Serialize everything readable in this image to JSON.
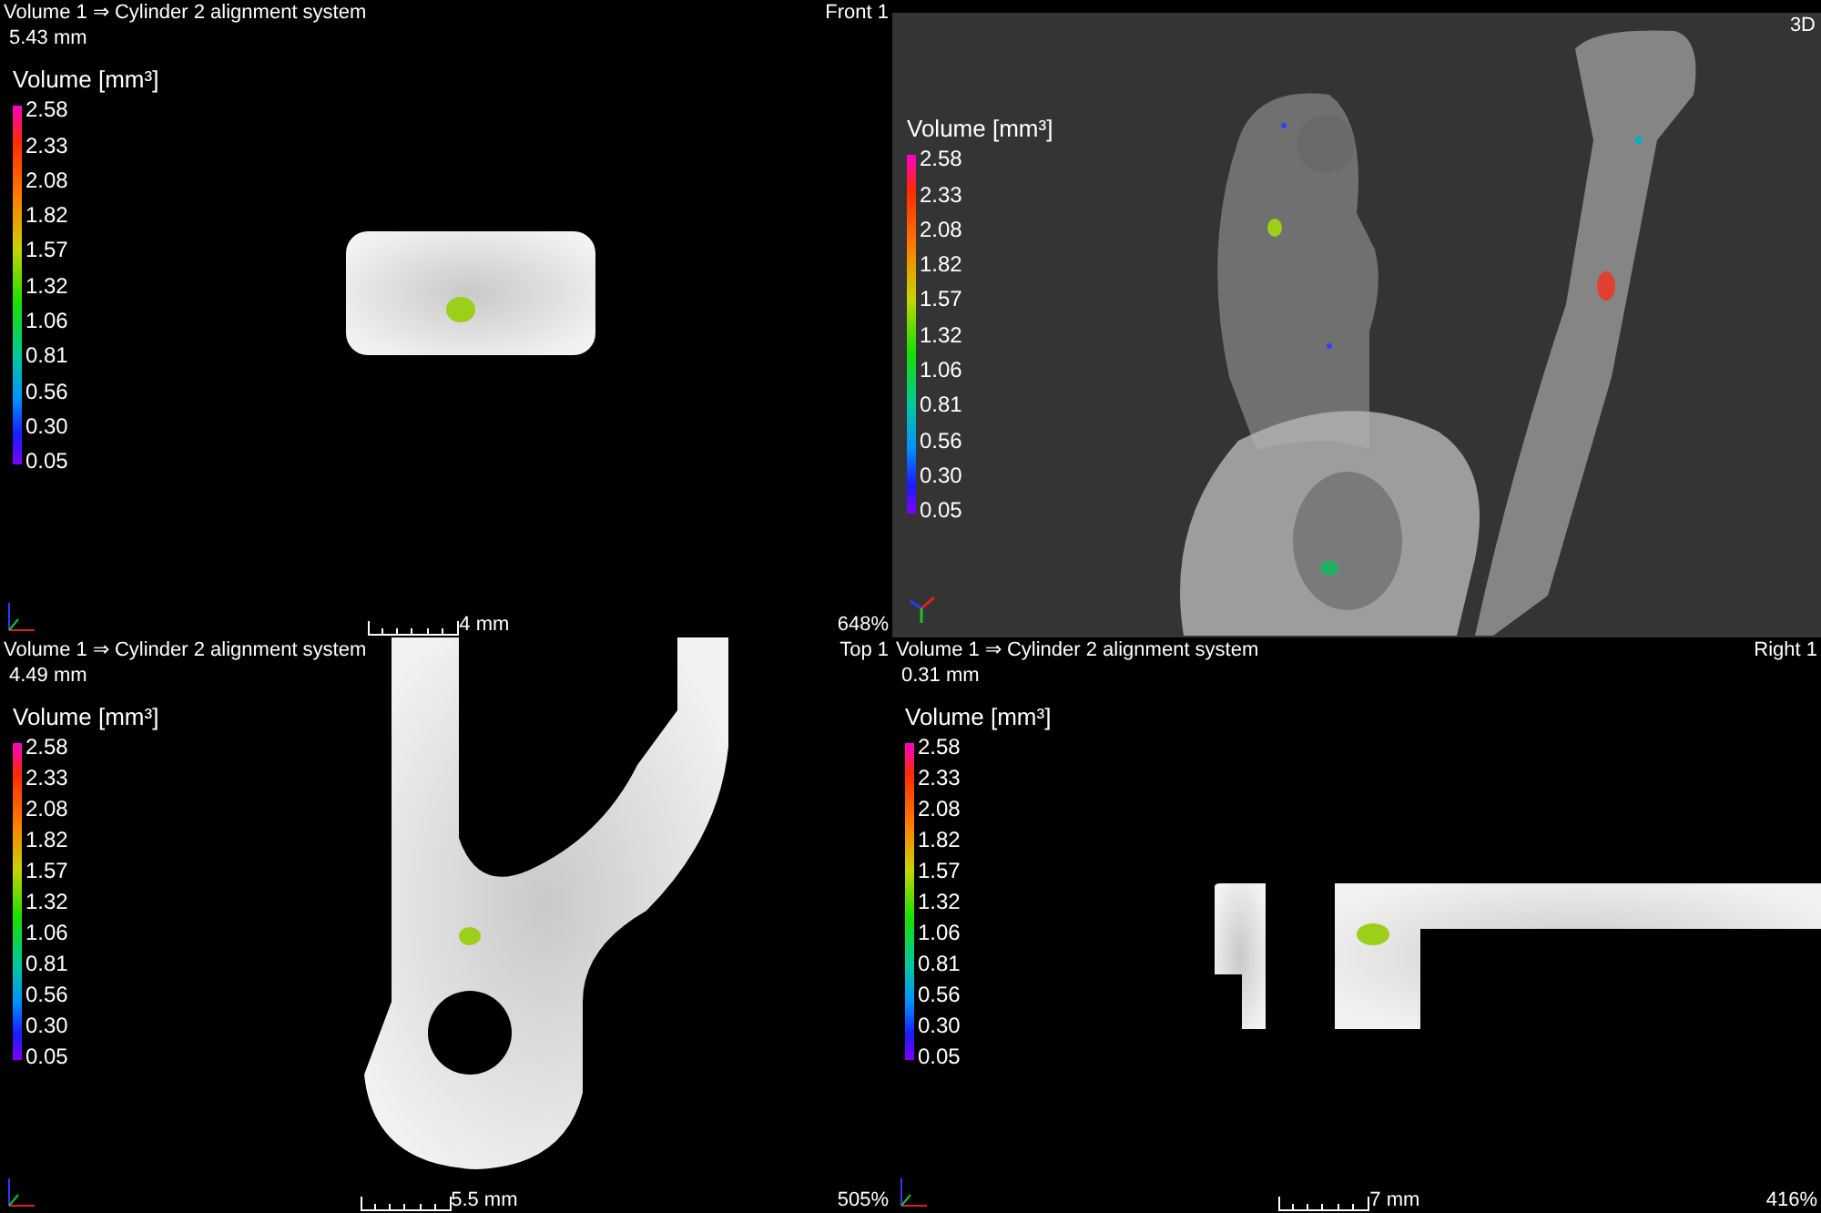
{
  "viewports": [
    {
      "kind": "slice",
      "title": "Volume 1 ⇒ Cylinder 2 alignment system",
      "thickness": "5.43 mm",
      "view_label": "Front 1",
      "legend": {
        "title": "Volume [mm³]",
        "ticks": [
          "2.58",
          "2.33",
          "2.08",
          "1.82",
          "1.57",
          "1.32",
          "1.06",
          "0.81",
          "0.56",
          "0.30",
          "0.05"
        ]
      },
      "scale": "4 mm",
      "zoom": "648%"
    },
    {
      "kind": "volume",
      "view_label": "3D",
      "legend": {
        "title": "Volume [mm³]",
        "ticks": [
          "2.58",
          "2.33",
          "2.08",
          "1.82",
          "1.57",
          "1.32",
          "1.06",
          "0.81",
          "0.56",
          "0.30",
          "0.05"
        ]
      }
    },
    {
      "kind": "slice",
      "title": "Volume 1 ⇒ Cylinder 2 alignment system",
      "thickness": "4.49 mm",
      "view_label": "Top 1",
      "legend": {
        "title": "Volume [mm³]",
        "ticks": [
          "2.58",
          "2.33",
          "2.08",
          "1.82",
          "1.57",
          "1.32",
          "1.06",
          "0.81",
          "0.56",
          "0.30",
          "0.05"
        ]
      },
      "scale": "5.5 mm",
      "zoom": "505%"
    },
    {
      "kind": "slice",
      "title": "Volume 1 ⇒ Cylinder 2 alignment system",
      "thickness": "0.31 mm",
      "view_label": "Right 1",
      "legend": {
        "title": "Volume [mm³]",
        "ticks": [
          "2.58",
          "2.33",
          "2.08",
          "1.82",
          "1.57",
          "1.32",
          "1.06",
          "0.81",
          "0.56",
          "0.30",
          "0.05"
        ]
      },
      "scale": "7 mm",
      "zoom": "416%"
    }
  ]
}
